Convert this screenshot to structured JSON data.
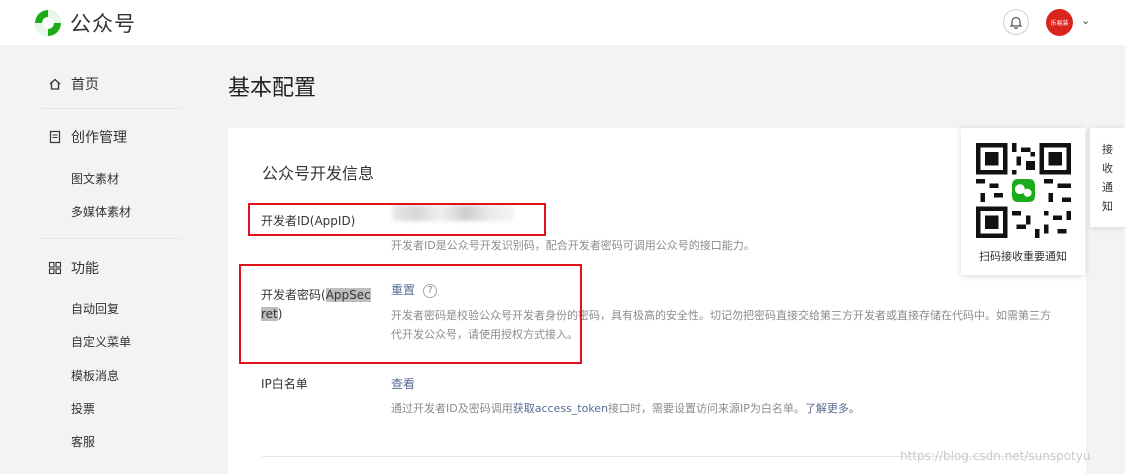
{
  "header": {
    "brand": "公众号",
    "avatar_text": "乐易装",
    "caret": "⌄"
  },
  "sidebar": {
    "home": "首页",
    "content_mgmt": "创作管理",
    "content_items": [
      "图文素材",
      "多媒体素材"
    ],
    "features": "功能",
    "feature_items": [
      "自动回复",
      "自定义菜单",
      "模板消息",
      "投票",
      "客服"
    ]
  },
  "main": {
    "page_title": "基本配置",
    "section_title": "公众号开发信息",
    "appid": {
      "label": "开发者ID(AppID)",
      "desc": "开发者ID是公众号开发识别码，配合开发者密码可调用公众号的接口能力。"
    },
    "secret": {
      "label_a": "开发者密码(",
      "label_b": "AppSec",
      "label_c": "ret",
      "label_d": ")",
      "action": "重置",
      "help": "?",
      "desc": "开发者密码是校验公众号开发者身份的密码，具有极高的安全性。切记勿把密码直接交给第三方开发者或直接存储在代码中。如需第三方代开发公众号，请使用授权方式接入。"
    },
    "ip": {
      "label": "IP白名单",
      "action": "查看",
      "desc_a": "通过开发者ID及密码调用",
      "desc_link": "获取access_token",
      "desc_b": "接口时，需要设置访问来源IP为白名单。",
      "desc_more": "了解更多。"
    }
  },
  "qr": {
    "caption": "扫码接收重要通知"
  },
  "side_tab": {
    "chars": [
      "接",
      "收",
      "通",
      "知"
    ]
  },
  "watermark": "https://blog.csdn.net/sunspotyu",
  "colors": {
    "highlight": "#e0121a",
    "link": "#576b95",
    "brand_green": "#1aad19",
    "avatar": "#d9251c"
  }
}
